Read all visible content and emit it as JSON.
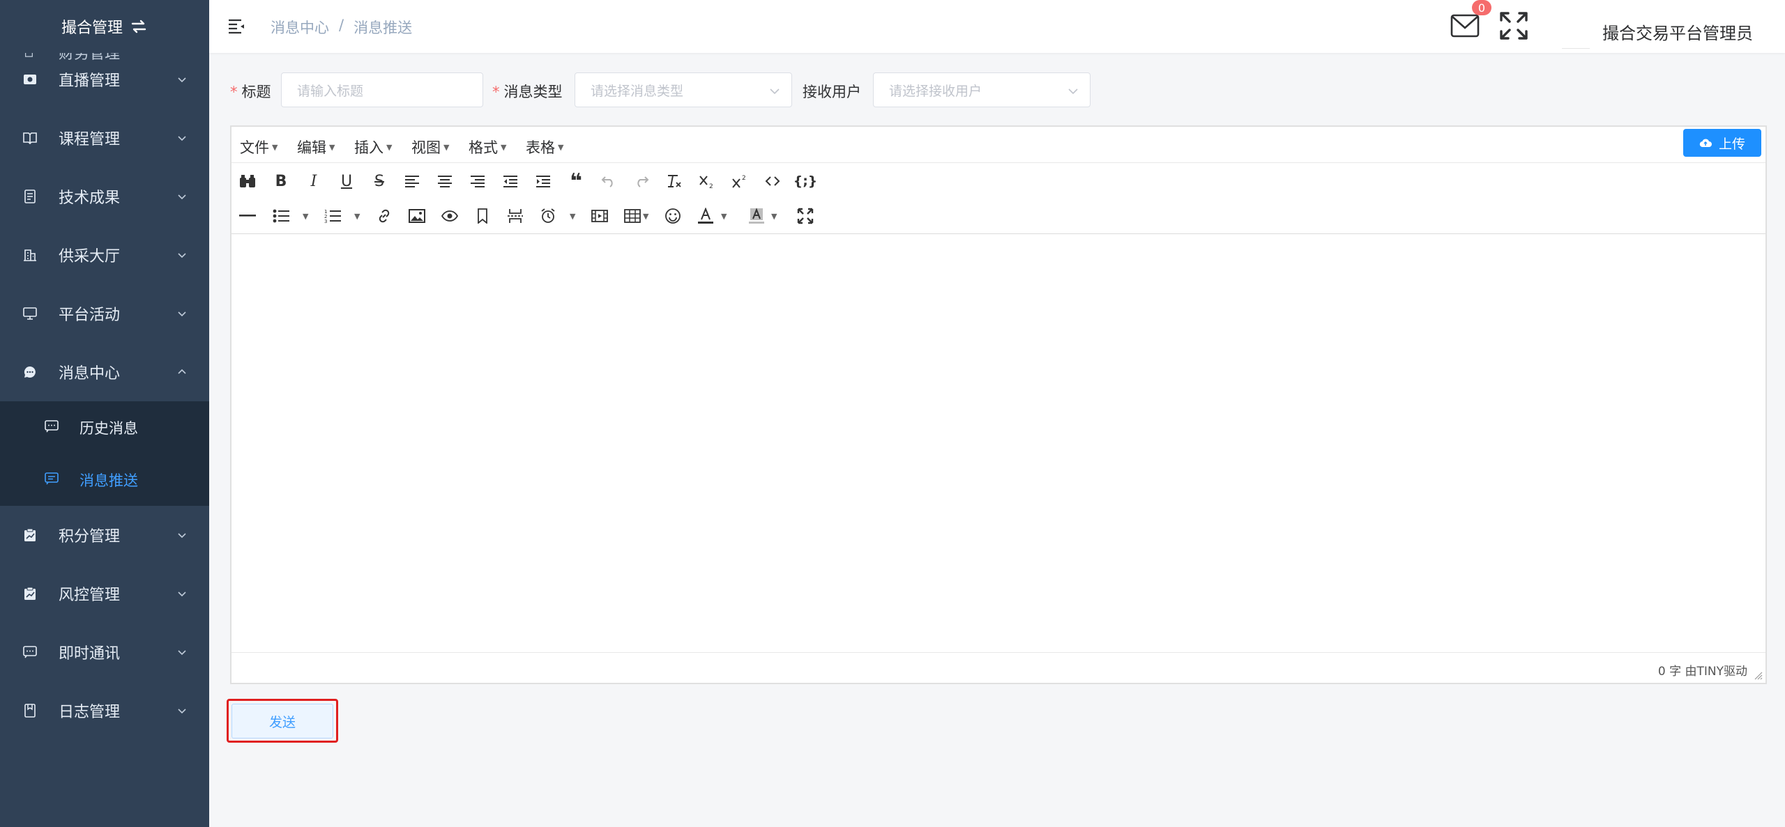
{
  "sidebar": {
    "logo_text": "撮合管理",
    "partial_item": "财务管理",
    "items": [
      {
        "label": "直播管理",
        "icon": "camera-icon"
      },
      {
        "label": "课程管理",
        "icon": "book-icon"
      },
      {
        "label": "技术成果",
        "icon": "document-icon"
      },
      {
        "label": "供采大厅",
        "icon": "building-icon"
      },
      {
        "label": "平台活动",
        "icon": "monitor-icon"
      },
      {
        "label": "消息中心",
        "icon": "chat-icon",
        "expanded": true
      },
      {
        "label": "积分管理",
        "icon": "chart-icon"
      },
      {
        "label": "风控管理",
        "icon": "shield-chart-icon"
      },
      {
        "label": "即时通讯",
        "icon": "message-icon"
      },
      {
        "label": "日志管理",
        "icon": "log-icon"
      }
    ],
    "sub_items": [
      {
        "label": "历史消息",
        "active": false
      },
      {
        "label": "消息推送",
        "active": true
      }
    ],
    "active_color": "#409eff"
  },
  "header": {
    "breadcrumb": [
      "消息中心",
      "/",
      "消息推送"
    ],
    "mail_badge": "0",
    "username": "撮合交易平台管理员"
  },
  "form": {
    "title_label": "标题",
    "title_placeholder": "请输入标题",
    "type_label": "消息类型",
    "type_placeholder": "请选择消息类型",
    "receiver_label": "接收用户",
    "receiver_placeholder": "请选择接收用户",
    "required_mark": "*"
  },
  "editor": {
    "menus": [
      "文件",
      "编辑",
      "插入",
      "视图",
      "格式",
      "表格"
    ],
    "upload_label": "上传",
    "word_count": "0 字 由TINY驱动"
  },
  "actions": {
    "send_label": "发送"
  }
}
